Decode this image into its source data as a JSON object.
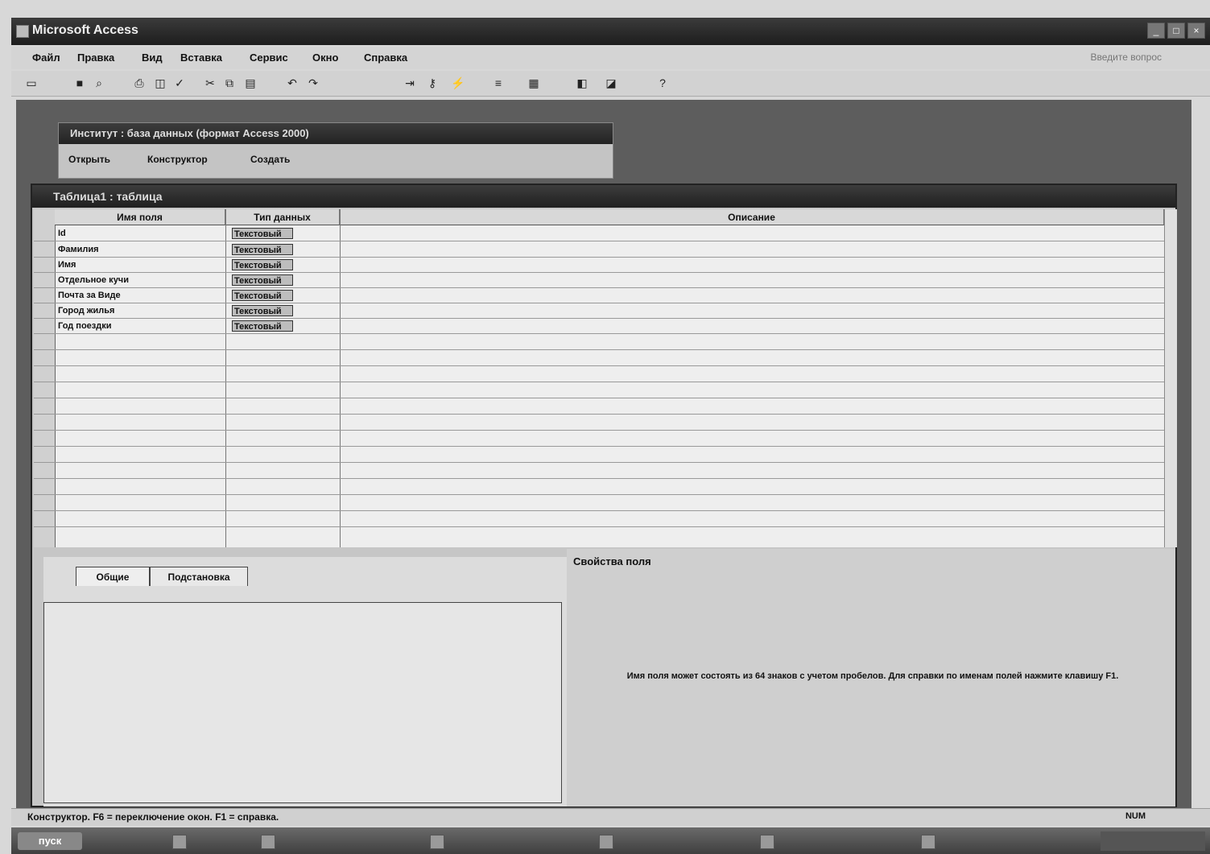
{
  "app": {
    "title": "Microsoft Access"
  },
  "menu": {
    "items": [
      "Файл",
      "Правка",
      "Вид",
      "Вставка",
      "Сервис",
      "Окно",
      "Справка"
    ],
    "help_hint": "Введите вопрос"
  },
  "db_window": {
    "title": "Институт : база данных (формат Access 2000)",
    "open": "Открыть",
    "design": "Конструктор",
    "create": "Создать"
  },
  "design_window": {
    "title": "Таблица1 : таблица"
  },
  "grid": {
    "headers": {
      "name": "Имя поля",
      "type": "Тип данных",
      "desc": "Описание"
    },
    "rows": [
      {
        "name": "Id",
        "type": "Текстовый"
      },
      {
        "name": "Фамилия",
        "type": "Текстовый"
      },
      {
        "name": "Имя",
        "type": "Текстовый"
      },
      {
        "name": "Отдельное кучи",
        "type": "Текстовый"
      },
      {
        "name": "Почта за Виде",
        "type": "Текстовый"
      },
      {
        "name": "Город жилья",
        "type": "Текстовый"
      },
      {
        "name": "Год поездки",
        "type": "Текстовый"
      }
    ]
  },
  "properties": {
    "tab_general": "Общие",
    "tab_lookup": "Подстановка",
    "caption": "Свойства поля",
    "hint_line1": "Имя поля может состоять из 64 знаков с учетом пробелов. Для справки по именам полей нажмите клавишу F1.",
    "hint_line2": ""
  },
  "status": {
    "text": "Конструктор. F6 = переключение окон. F1 = справка.",
    "mode": "NUM"
  },
  "taskbar": {
    "start": "пуск",
    "tray": ""
  }
}
